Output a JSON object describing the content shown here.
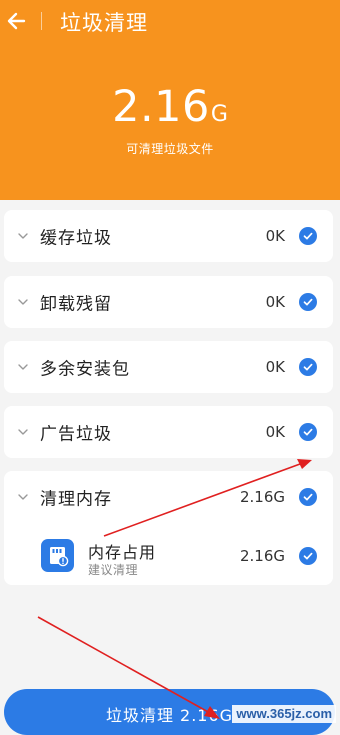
{
  "header": {
    "title": "垃圾清理",
    "back_icon": "arrow-left-icon",
    "junk_size_value": "2.16",
    "junk_size_unit": "G",
    "junk_size_caption": "可清理垃圾文件",
    "background_color": "#f7931e"
  },
  "categories": [
    {
      "label": "缓存垃圾",
      "size": "0K",
      "checked": true
    },
    {
      "label": "卸载残留",
      "size": "0K",
      "checked": true
    },
    {
      "label": "多余安装包",
      "size": "0K",
      "checked": true
    },
    {
      "label": "广告垃圾",
      "size": "0K",
      "checked": true
    },
    {
      "label": "清理内存",
      "size": "2.16G",
      "checked": true,
      "children": [
        {
          "name": "内存占用",
          "hint": "建议清理",
          "size": "2.16G",
          "checked": true,
          "icon": "memory-card-icon"
        }
      ]
    }
  ],
  "footer": {
    "clean_button_label": "垃圾清理 2.16G"
  },
  "watermark": "www.365jz.com",
  "colors": {
    "accent": "#2c7be5",
    "annotation_arrow": "#e02020"
  }
}
